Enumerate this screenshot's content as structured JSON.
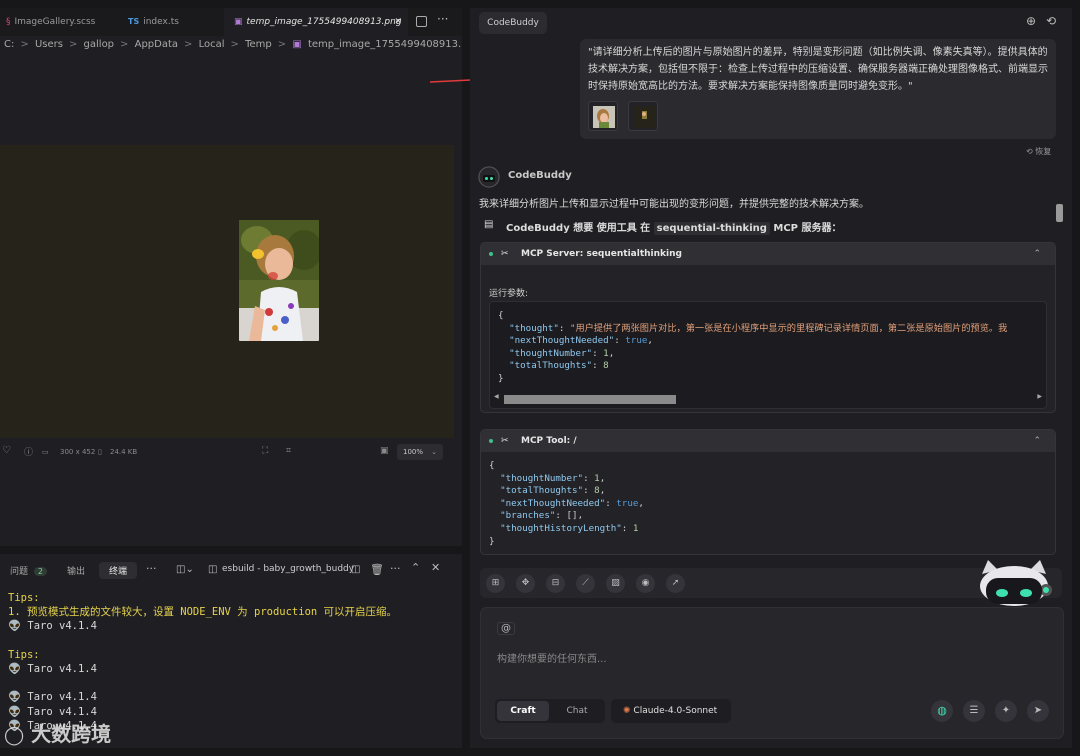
{
  "editor": {
    "tabs": [
      {
        "label": "ImageGallery.scss",
        "icon": "scss-icon"
      },
      {
        "label": "index.ts",
        "icon": "TS"
      },
      {
        "label": "temp_image_1755499408913.png",
        "icon": "image-icon"
      }
    ],
    "breadcrumb": [
      "C:",
      "Users",
      "gallop",
      "AppData",
      "Local",
      "Temp",
      "temp_image_1755499408913.png"
    ],
    "image_info": {
      "dimensions": "300 x 452",
      "size": "24.4 KB",
      "zoom": "100%"
    }
  },
  "panel": {
    "tabs": [
      {
        "label": "问题",
        "badge": "2"
      },
      {
        "label": "输出"
      },
      {
        "label": "终端"
      }
    ],
    "terminal_name": "esbuild - baby_growth_buddy",
    "lines": [
      {
        "text": "Tips:",
        "color": "yellow"
      },
      {
        "text": "1. 预览模式生成的文件较大，设置 NODE_ENV 为 production 可以开启压缩。",
        "color": "yellow"
      },
      {
        "text": "👽 Taro v4.1.4",
        "color": "white"
      },
      {
        "text": "",
        "color": "white"
      },
      {
        "text": "Tips:",
        "color": "yellow"
      },
      {
        "text": "👽 Taro v4.1.4",
        "color": "white"
      },
      {
        "text": "",
        "color": "white"
      },
      {
        "text": "👽 Taro v4.1.4",
        "color": "white"
      },
      {
        "text": "👽 Taro v4.1.4",
        "color": "white"
      },
      {
        "text": "👽 Taro v4.1.4",
        "color": "white"
      }
    ]
  },
  "chat": {
    "badge": "CodeBuddy",
    "user_message": "\"请详细分析上传后的图片与原始图片的差异，特别是变形问题（如比例失调、像素失真等）。提供具体的技术解决方案，包括但不限于：检查上传过程中的压缩设置、确保服务器端正确处理图像格式、前端显示时保持原始宽高比的方法。要求解决方案能保持图像质量同时避免变形。\"",
    "restore_label": "恢复",
    "bot_name": "CodeBuddy",
    "intro": "我来详细分析图片上传和显示过程中可能出现的变形问题，并提供完整的技术解决方案。",
    "tool_use": {
      "prefix": "CodeBuddy 想要 使用工具 在",
      "server": "sequential-thinking",
      "suffix": "MCP 服务器："
    },
    "mcp_server": {
      "title": "MCP Server: sequentialthinking",
      "params_label": "运行参数:",
      "thought": "\"用户提供了两张图片对比，第一张是在小程序中显示的里程碑记录详情页面，第二张是原始图片的预览。我",
      "nextThoughtNeeded": "true",
      "thoughtNumber": "1",
      "totalThoughts": "8"
    },
    "mcp_tool": {
      "title": "MCP Tool: /",
      "thoughtNumber": "1",
      "totalThoughts": "8",
      "nextThoughtNeeded": "true",
      "branches": "[]",
      "thoughtHistoryLength": "1"
    },
    "input_placeholder": "构建你想要的任何东西...",
    "mention": "@",
    "modes": [
      "Craft",
      "Chat"
    ],
    "model": "Claude-4.0-Sonnet"
  },
  "watermark": "大数跨境"
}
